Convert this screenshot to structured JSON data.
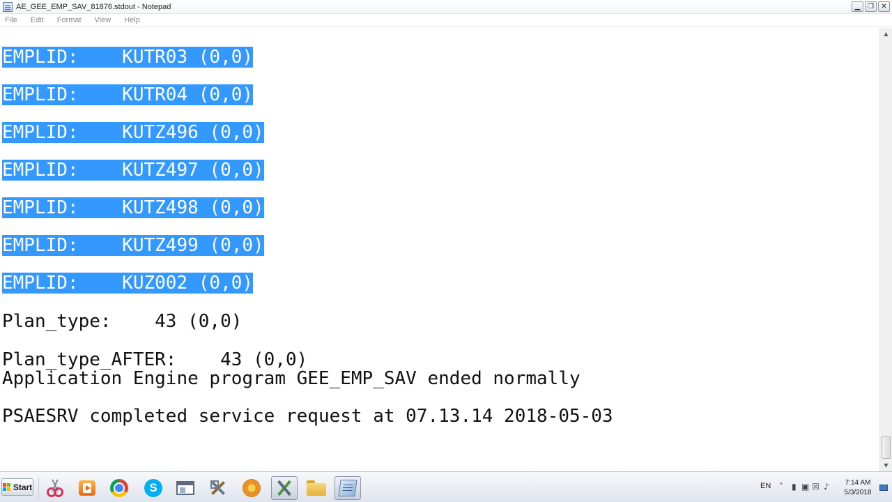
{
  "window": {
    "title": "AE_GEE_EMP_SAV_81876.stdout - Notepad",
    "buttons": {
      "minimize": "▁",
      "restore": "❐",
      "close": "✕"
    }
  },
  "menu": [
    "File",
    "Edit",
    "Format",
    "View",
    "Help"
  ],
  "editor": {
    "lines": [
      {
        "text": "EMPLID:    KUTR03 (0,0)",
        "selected": true
      },
      {
        "text": "EMPLID:    KUTR04 (0,0)",
        "selected": true
      },
      {
        "text": "EMPLID:    KUTZ496 (0,0)",
        "selected": true
      },
      {
        "text": "EMPLID:    KUTZ497 (0,0)",
        "selected": true
      },
      {
        "text": "EMPLID:    KUTZ498 (0,0)",
        "selected": true
      },
      {
        "text": "EMPLID:    KUTZ499 (0,0)",
        "selected": true
      },
      {
        "text": "EMPLID:    KUZ002 (0,0)",
        "selected": true
      },
      {
        "text": "Plan_type:    43 (0,0)",
        "selected": false
      },
      {
        "text": "Plan_type_AFTER:    43 (0,0)",
        "selected": false
      },
      {
        "text": "Application Engine program GEE_EMP_SAV ended normally",
        "selected": false
      },
      {
        "text": "PSAESRV completed service request at 07.13.14 2018-05-03",
        "selected": false
      }
    ]
  },
  "scrollbar": {
    "up_arrow": "▲",
    "down_arrow": "▼"
  },
  "taskbar": {
    "start_label": "Start",
    "start_colors": [
      "#f25022",
      "#7fba00",
      "#00a4ef",
      "#ffb900"
    ],
    "skype_glyph": "S",
    "apps": [
      {
        "name": "snipping-tool-icon"
      },
      {
        "name": "media-player-icon"
      },
      {
        "name": "chrome-icon"
      },
      {
        "name": "skype-icon"
      },
      {
        "name": "window-app-icon"
      },
      {
        "name": "tools-icon"
      },
      {
        "name": "flower-app-icon"
      },
      {
        "name": "wrench-app-icon"
      },
      {
        "name": "folder-icon"
      },
      {
        "name": "notepad-icon"
      }
    ],
    "tray": {
      "language": "EN",
      "chevron": "˄",
      "clock_time": "7:14 AM",
      "clock_date": "5/3/2018"
    }
  },
  "colors": {
    "selection": "#3399ff",
    "selection_text": "#ffffff"
  }
}
